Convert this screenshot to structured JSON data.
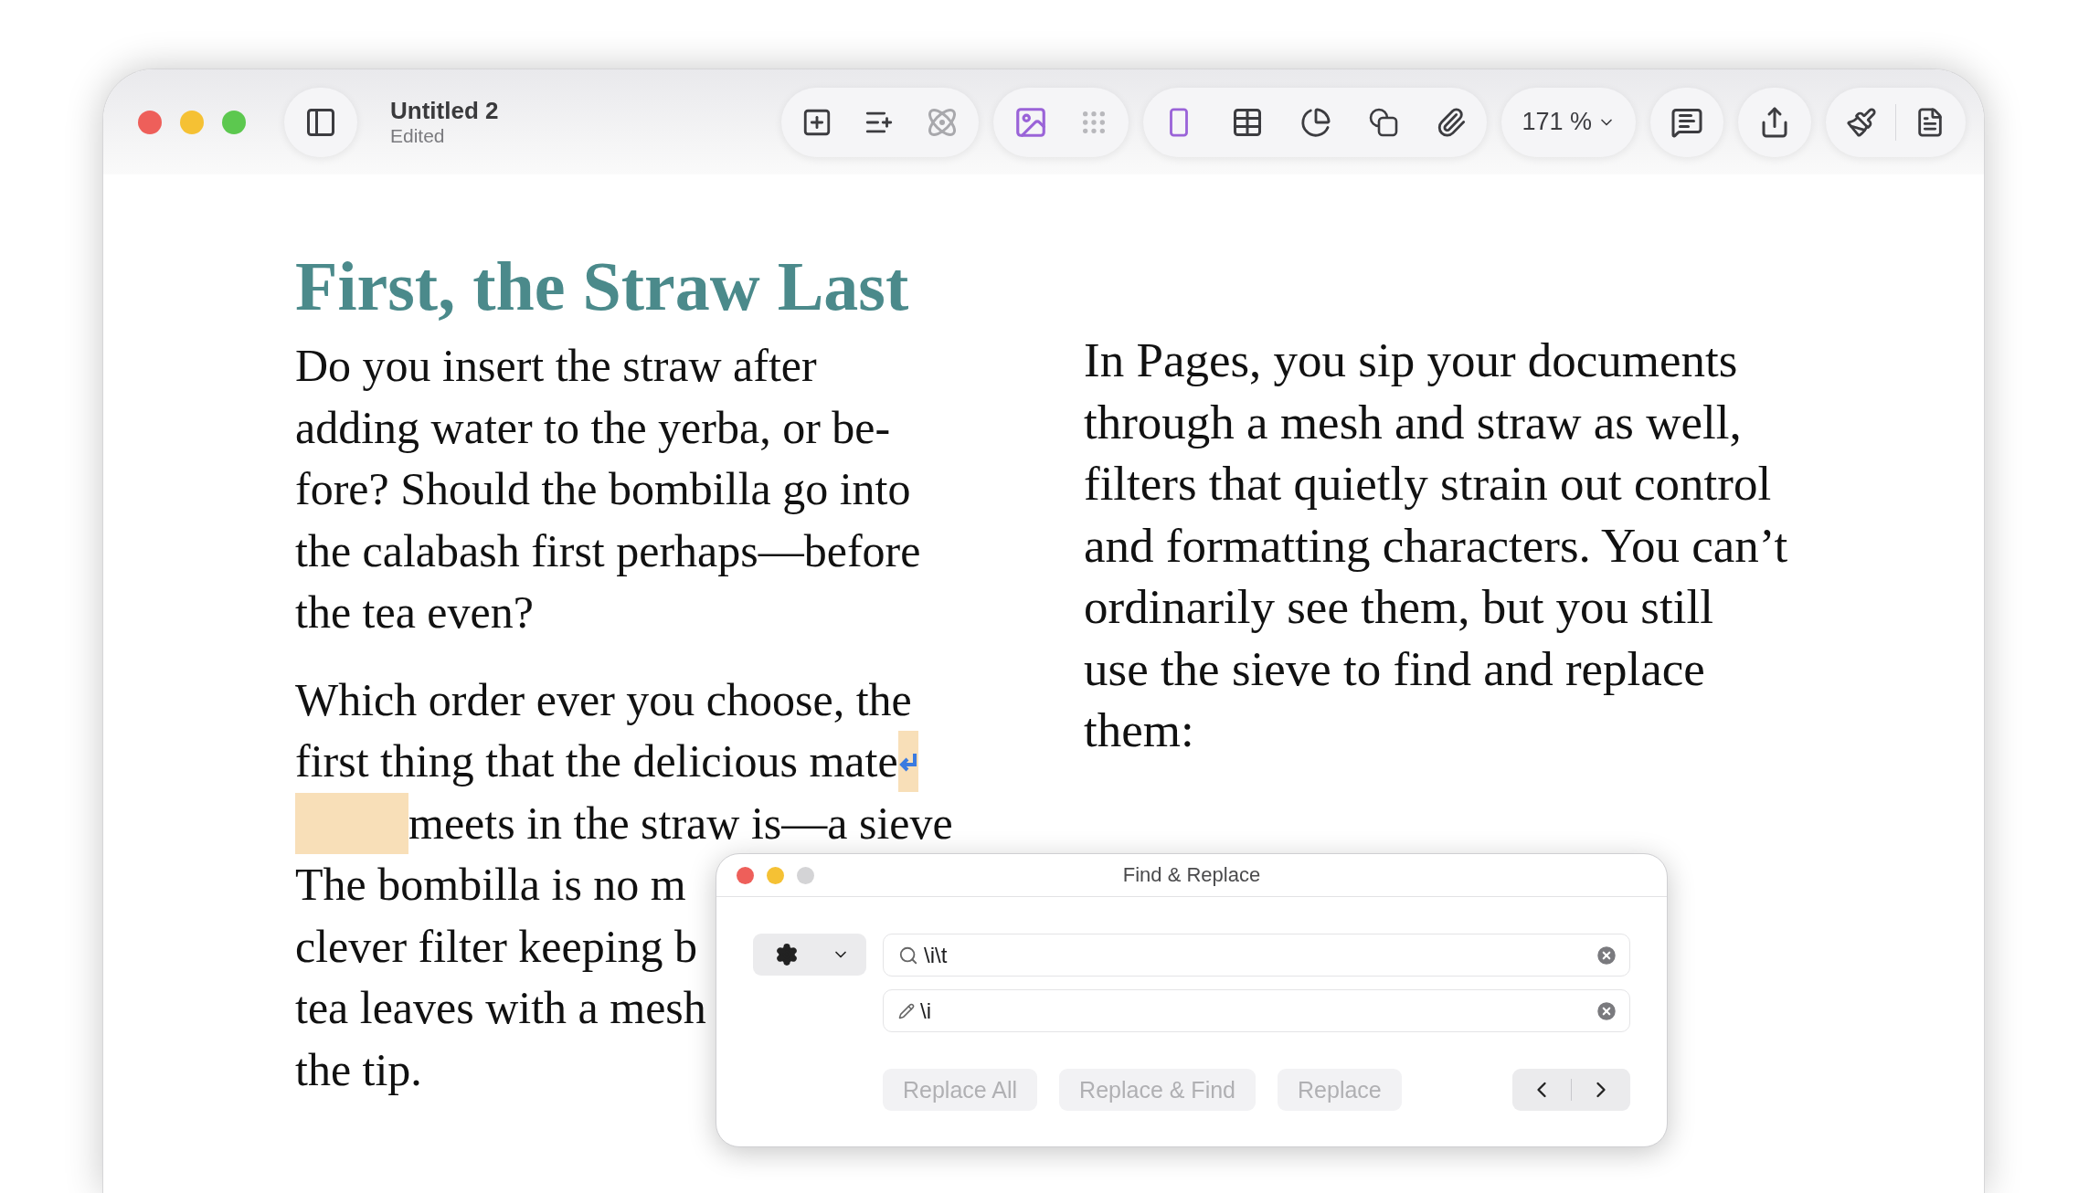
{
  "document": {
    "title": "Untitled 2",
    "status": "Edited"
  },
  "toolbar": {
    "zoom": "171 %"
  },
  "page": {
    "heading": "First, the Straw Last",
    "left_column": [
      {
        "lines": [
          {
            "text": "Do you insert the straw after"
          },
          {
            "text": "adding water to the yerba, or be-"
          },
          {
            "text": "fore? Should the bombilla go into"
          },
          {
            "text": "the calabash first perhaps—before"
          },
          {
            "text": "the tea even?"
          }
        ]
      },
      {
        "lines": [
          {
            "text": "Which order ever you choose, the"
          },
          {
            "text": "first thing that the delicious mate",
            "kind": "return"
          },
          {
            "text": "meets in the straw is—a sieve",
            "kind": "tab"
          },
          {
            "text": "The bombilla is no m"
          },
          {
            "text": "clever filter keeping b"
          },
          {
            "text": "tea leaves with a mesh"
          },
          {
            "text": "the tip."
          }
        ]
      }
    ],
    "right_column": {
      "lines": [
        {
          "text": "In Pages, you sip your documents"
        },
        {
          "text": "through a mesh and straw as well,"
        },
        {
          "text": "filters that quietly strain out control"
        },
        {
          "text": "and formatting characters. You can’t"
        },
        {
          "text": "ordinarily see them, but you still"
        },
        {
          "text": "use the sieve to find and replace"
        },
        {
          "text": "them:"
        }
      ]
    }
  },
  "find_dialog": {
    "title": "Find & Replace",
    "find": {
      "value": "\\i\\t"
    },
    "replace": {
      "value": "\\i"
    },
    "buttons": [
      {
        "label": "Replace All",
        "disabled": true
      },
      {
        "label": "Replace & Find",
        "disabled": true
      },
      {
        "label": "Replace",
        "disabled": true
      }
    ]
  }
}
